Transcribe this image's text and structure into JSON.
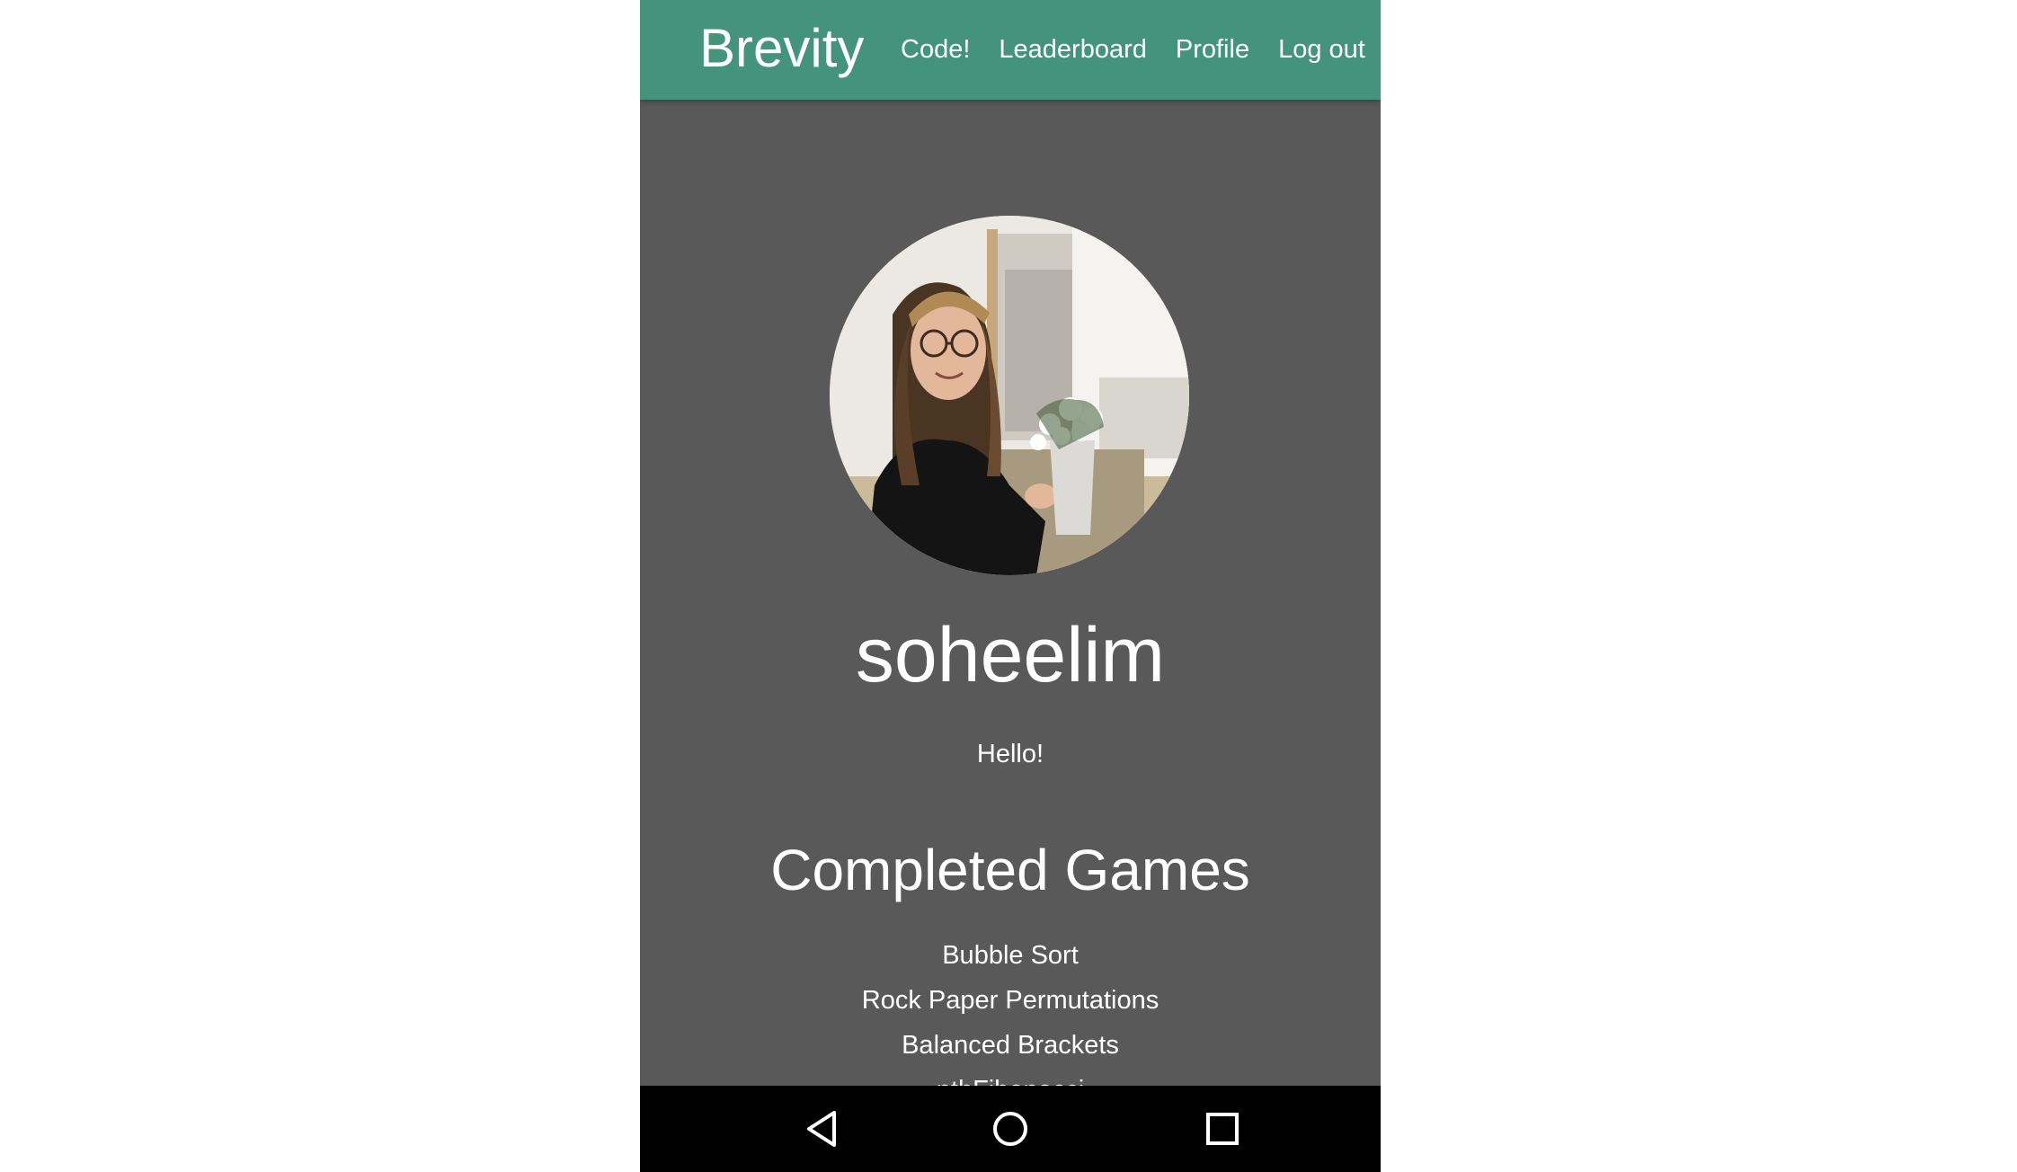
{
  "navbar": {
    "brand": "Brevity",
    "links": [
      "Code!",
      "Leaderboard",
      "Profile",
      "Log out"
    ],
    "background_color": "#43947a"
  },
  "profile": {
    "username": "soheelim",
    "bio": "Hello!",
    "avatar_icon": "user-photo"
  },
  "completed_games": {
    "heading": "Completed Games",
    "items": [
      "Bubble Sort",
      "Rock Paper Permutations",
      "Balanced Brackets",
      "nthFibonacci"
    ]
  },
  "system_nav": {
    "back_icon": "back-triangle-icon",
    "home_icon": "home-circle-icon",
    "recents_icon": "recents-square-icon"
  },
  "colors": {
    "page_background": "#595959",
    "system_bar": "#000000"
  }
}
